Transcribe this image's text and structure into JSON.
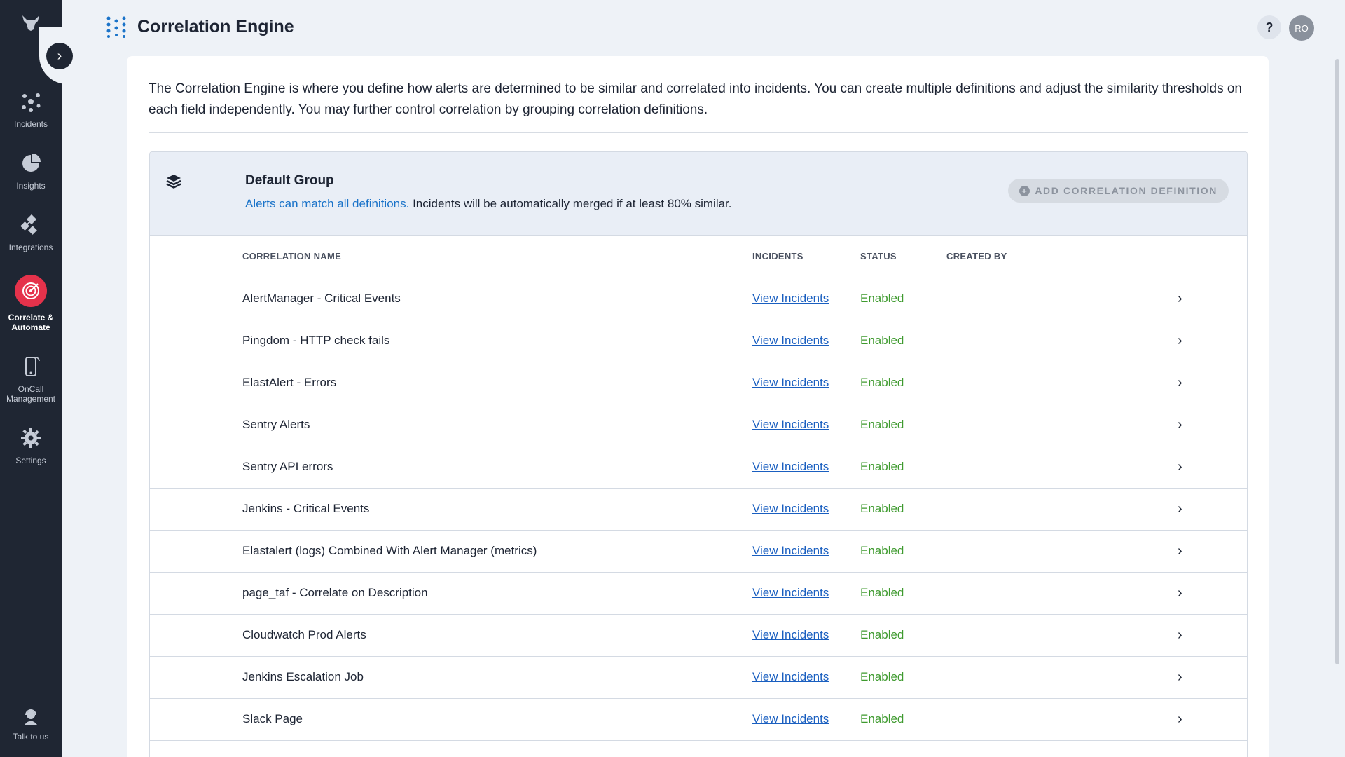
{
  "header": {
    "title": "Correlation Engine",
    "help": "?",
    "avatar_initials": "RO"
  },
  "sidebar": {
    "items": [
      {
        "label": "Incidents",
        "icon": "incidents-icon"
      },
      {
        "label": "Insights",
        "icon": "pie-chart-icon"
      },
      {
        "label": "Integrations",
        "icon": "integrations-icon"
      },
      {
        "label": "Correlate & Automate",
        "icon": "target-icon",
        "active": true
      },
      {
        "label": "OnCall Management",
        "icon": "phone-icon"
      },
      {
        "label": "Settings",
        "icon": "gear-icon"
      }
    ],
    "talk_label": "Talk to us"
  },
  "intro": "The Correlation Engine is where you define how alerts are determined to be similar and correlated into incidents. You can create multiple definitions and adjust the similarity thresholds on each field independently. You may further control correlation by grouping correlation definitions.",
  "group": {
    "title": "Default Group",
    "match_link": "Alerts can match all definitions.",
    "merge_text": "Incidents will be automatically merged if at least 80% similar.",
    "add_button": "ADD CORRELATION DEFINITION"
  },
  "table": {
    "headers": {
      "name": "CORRELATION NAME",
      "incidents": "INCIDENTS",
      "status": "STATUS",
      "created_by": "CREATED BY"
    },
    "link_label": "View Incidents",
    "rows": [
      {
        "name": "AlertManager - Critical Events",
        "status": "Enabled"
      },
      {
        "name": "Pingdom - HTTP check fails",
        "status": "Enabled"
      },
      {
        "name": "ElastAlert - Errors",
        "status": "Enabled"
      },
      {
        "name": "Sentry Alerts",
        "status": "Enabled"
      },
      {
        "name": "Sentry API errors",
        "status": "Enabled"
      },
      {
        "name": "Jenkins - Critical Events",
        "status": "Enabled"
      },
      {
        "name": "Elastalert (logs) Combined With Alert Manager (metrics)",
        "status": "Enabled"
      },
      {
        "name": "page_taf - Correlate on Description",
        "status": "Enabled"
      },
      {
        "name": "Cloudwatch Prod Alerts",
        "status": "Enabled"
      },
      {
        "name": "Jenkins Escalation Job",
        "status": "Enabled"
      },
      {
        "name": "Slack Page",
        "status": "Enabled"
      }
    ]
  },
  "colors": {
    "sidebar": "#1f2633",
    "accent_active": "#e5324b",
    "link": "#1a5fc0",
    "enabled": "#3e9a2e"
  }
}
